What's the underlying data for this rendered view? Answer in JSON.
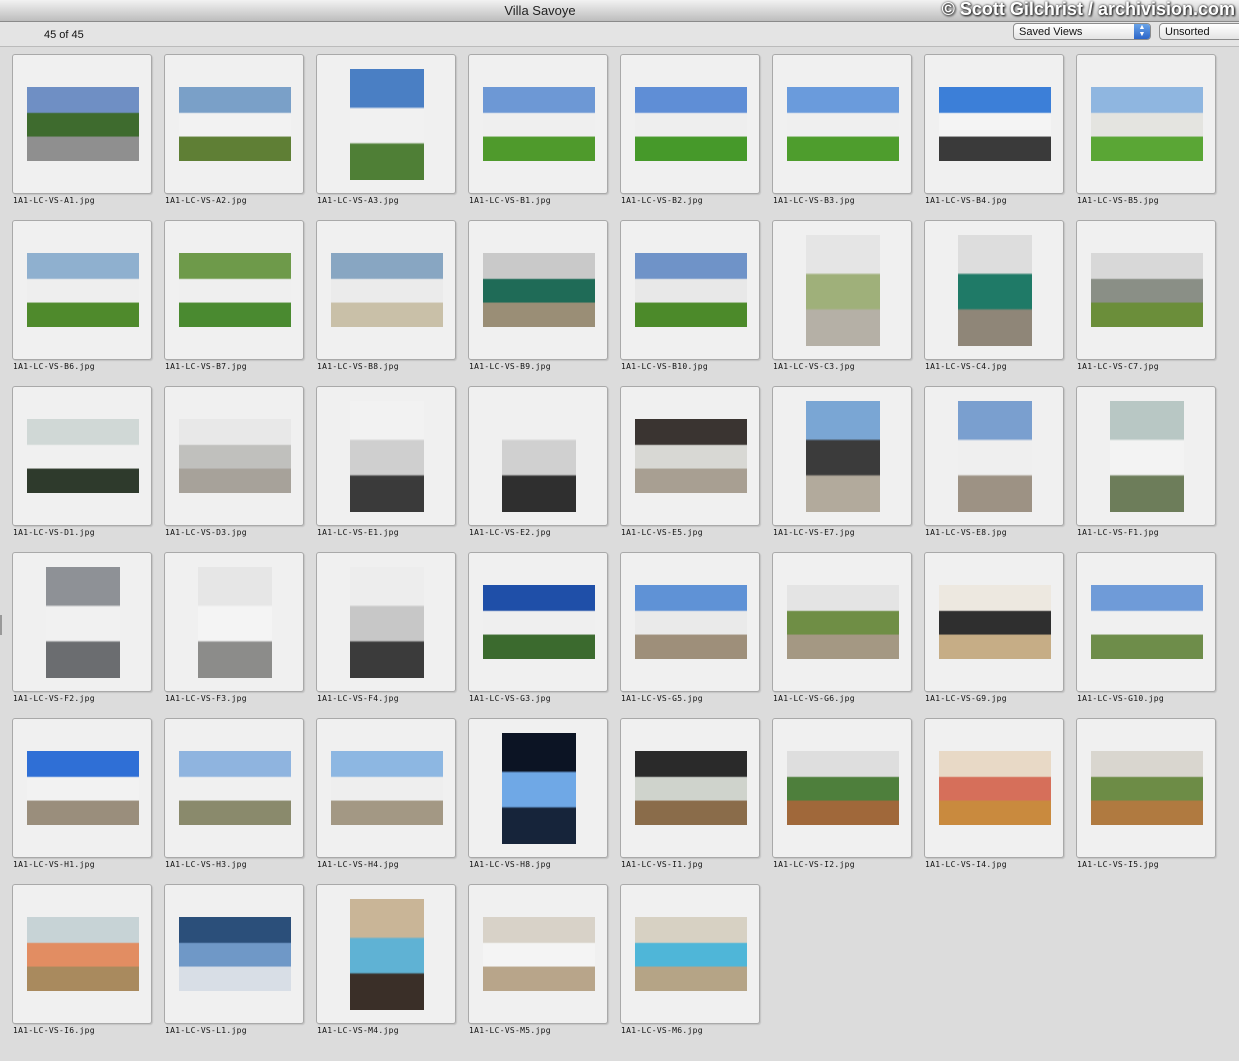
{
  "window": {
    "title": "Villa Savoye",
    "copyright": "© Scott Gilchrist / archivision.com"
  },
  "toolbar": {
    "count": "45 of 45",
    "saved_views": "Saved Views",
    "sort": "Unsorted"
  },
  "items": [
    {
      "file": "1A1-LC-VS-A1.jpg",
      "o": "l",
      "sky": "#6f8fc4",
      "mid": "#3e6b2e",
      "gnd": "#8f8f8f"
    },
    {
      "file": "1A1-LC-VS-A2.jpg",
      "o": "l",
      "sky": "#7aa0c8",
      "mid": "#f2f2f2",
      "gnd": "#5f7f35"
    },
    {
      "file": "1A1-LC-VS-A3.jpg",
      "o": "p",
      "sky": "#4a7fc4",
      "mid": "#f1f1f1",
      "gnd": "#4f7f36"
    },
    {
      "file": "1A1-LC-VS-B1.jpg",
      "o": "l",
      "sky": "#6d98d5",
      "mid": "#efefef",
      "gnd": "#4f9a2c"
    },
    {
      "file": "1A1-LC-VS-B2.jpg",
      "o": "l",
      "sky": "#5f8ed6",
      "mid": "#eeeeee",
      "gnd": "#46992a"
    },
    {
      "file": "1A1-LC-VS-B3.jpg",
      "o": "l",
      "sky": "#6a9bdc",
      "mid": "#efefef",
      "gnd": "#4e9d2d"
    },
    {
      "file": "1A1-LC-VS-B4.jpg",
      "o": "l",
      "sky": "#3c7fd8",
      "mid": "#f4f4f4",
      "gnd": "#3a3a3a"
    },
    {
      "file": "1A1-LC-VS-B5.jpg",
      "o": "l",
      "sky": "#8fb6e0",
      "mid": "#e4e4e0",
      "gnd": "#5aa635"
    },
    {
      "file": "1A1-LC-VS-B6.jpg",
      "o": "l",
      "sky": "#8fb0cf",
      "mid": "#eeeeee",
      "gnd": "#4f8a2c"
    },
    {
      "file": "1A1-LC-VS-B7.jpg",
      "o": "l",
      "sky": "#6e9a4a",
      "mid": "#efefef",
      "gnd": "#4a8a30"
    },
    {
      "file": "1A1-LC-VS-B8.jpg",
      "o": "l",
      "sky": "#88a6c2",
      "mid": "#ebebeb",
      "gnd": "#c9c0a8"
    },
    {
      "file": "1A1-LC-VS-B9.jpg",
      "o": "l",
      "sky": "#c9c9c9",
      "mid": "#1f6b57",
      "gnd": "#9a8e76"
    },
    {
      "file": "1A1-LC-VS-B10.jpg",
      "o": "l",
      "sky": "#6f93c8",
      "mid": "#e8e8e8",
      "gnd": "#4c8a2a"
    },
    {
      "file": "1A1-LC-VS-C3.jpg",
      "o": "p",
      "sky": "#e5e5e5",
      "mid": "#9fb07a",
      "gnd": "#b5b0a6"
    },
    {
      "file": "1A1-LC-VS-C4.jpg",
      "o": "p",
      "sky": "#dddddd",
      "mid": "#1f7a67",
      "gnd": "#8f8678"
    },
    {
      "file": "1A1-LC-VS-C7.jpg",
      "o": "l",
      "sky": "#d8d8d8",
      "mid": "#8a8f86",
      "gnd": "#6b8e3a"
    },
    {
      "file": "1A1-LC-VS-D1.jpg",
      "o": "l",
      "sky": "#d0d8d6",
      "mid": "#f0f0f0",
      "gnd": "#2e3a2c"
    },
    {
      "file": "1A1-LC-VS-D3.jpg",
      "o": "l",
      "sky": "#e8e8e8",
      "mid": "#c0c0bd",
      "gnd": "#a7a29a"
    },
    {
      "file": "1A1-LC-VS-E1.jpg",
      "o": "p",
      "sky": "#f2f2f2",
      "mid": "#cfcfcf",
      "gnd": "#3a3a3a"
    },
    {
      "file": "1A1-LC-VS-E2.jpg",
      "o": "p",
      "sky": "#f0f0f0",
      "mid": "#d0d0d0",
      "gnd": "#2f2f2f"
    },
    {
      "file": "1A1-LC-VS-E5.jpg",
      "o": "l",
      "sky": "#3a3431",
      "mid": "#d8d8d4",
      "gnd": "#a89f92"
    },
    {
      "file": "1A1-LC-VS-E7.jpg",
      "o": "p",
      "sky": "#7aa6d4",
      "mid": "#3b3b3b",
      "gnd": "#b2aa9c"
    },
    {
      "file": "1A1-LC-VS-E8.jpg",
      "o": "p",
      "sky": "#7a9fcf",
      "mid": "#efefef",
      "gnd": "#9d9284"
    },
    {
      "file": "1A1-LC-VS-F1.jpg",
      "o": "p",
      "sky": "#b8c7c4",
      "mid": "#f3f3f3",
      "gnd": "#6d7d5a"
    },
    {
      "file": "1A1-LC-VS-F2.jpg",
      "o": "p",
      "sky": "#8e9196",
      "mid": "#f1f1f1",
      "gnd": "#6b6d70"
    },
    {
      "file": "1A1-LC-VS-F3.jpg",
      "o": "p",
      "sky": "#e6e6e6",
      "mid": "#f4f4f4",
      "gnd": "#8c8c8a"
    },
    {
      "file": "1A1-LC-VS-F4.jpg",
      "o": "p",
      "sky": "#ededed",
      "mid": "#c7c7c7",
      "gnd": "#3b3b3b"
    },
    {
      "file": "1A1-LC-VS-G3.jpg",
      "o": "l",
      "sky": "#1f4fa8",
      "mid": "#efefef",
      "gnd": "#3b6a2e"
    },
    {
      "file": "1A1-LC-VS-G5.jpg",
      "o": "l",
      "sky": "#5f92d6",
      "mid": "#eaeaea",
      "gnd": "#9e8f7a"
    },
    {
      "file": "1A1-LC-VS-G6.jpg",
      "o": "l",
      "sky": "#e4e4e4",
      "mid": "#6f8e45",
      "gnd": "#a49883"
    },
    {
      "file": "1A1-LC-VS-G9.jpg",
      "o": "l",
      "sky": "#ede8e0",
      "mid": "#2f2f2f",
      "gnd": "#c6ad86"
    },
    {
      "file": "1A1-LC-VS-G10.jpg",
      "o": "l",
      "sky": "#6f9bd8",
      "mid": "#f0f0f0",
      "gnd": "#6e8d4a"
    },
    {
      "file": "1A1-LC-VS-H1.jpg",
      "o": "l",
      "sky": "#2f6fd6",
      "mid": "#f2f2f2",
      "gnd": "#9a8e7c"
    },
    {
      "file": "1A1-LC-VS-H3.jpg",
      "o": "l",
      "sky": "#8fb4df",
      "mid": "#f0f0f0",
      "gnd": "#8a8a6c"
    },
    {
      "file": "1A1-LC-VS-H4.jpg",
      "o": "l",
      "sky": "#8db7e2",
      "mid": "#eeeeee",
      "gnd": "#a39884"
    },
    {
      "file": "1A1-LC-VS-H8.jpg",
      "o": "p",
      "sky": "#0c1424",
      "mid": "#6fa8e6",
      "gnd": "#16243a"
    },
    {
      "file": "1A1-LC-VS-I1.jpg",
      "o": "l",
      "sky": "#2a2a2a",
      "mid": "#cfd3cc",
      "gnd": "#8a6c4a"
    },
    {
      "file": "1A1-LC-VS-I2.jpg",
      "o": "l",
      "sky": "#dedede",
      "mid": "#4e7f3c",
      "gnd": "#a0683a"
    },
    {
      "file": "1A1-LC-VS-I4.jpg",
      "o": "l",
      "sky": "#e8d9c6",
      "mid": "#d66f5a",
      "gnd": "#c98a3e"
    },
    {
      "file": "1A1-LC-VS-I5.jpg",
      "o": "l",
      "sky": "#d9d6cf",
      "mid": "#6d8c46",
      "gnd": "#b07a40"
    },
    {
      "file": "1A1-LC-VS-I6.jpg",
      "o": "l",
      "sky": "#c7d3d6",
      "mid": "#e28d62",
      "gnd": "#a98a5e"
    },
    {
      "file": "1A1-LC-VS-L1.jpg",
      "o": "l",
      "sky": "#2b4f7a",
      "mid": "#6f98c7",
      "gnd": "#d8dee6"
    },
    {
      "file": "1A1-LC-VS-M4.jpg",
      "o": "p",
      "sky": "#c9b597",
      "mid": "#5fb2d4",
      "gnd": "#3a2f28"
    },
    {
      "file": "1A1-LC-VS-M5.jpg",
      "o": "l",
      "sky": "#d8d2c8",
      "mid": "#f4f4f4",
      "gnd": "#b8a58a"
    },
    {
      "file": "1A1-LC-VS-M6.jpg",
      "o": "l",
      "sky": "#d7d1c3",
      "mid": "#4fb6d8",
      "gnd": "#b5a486"
    }
  ]
}
